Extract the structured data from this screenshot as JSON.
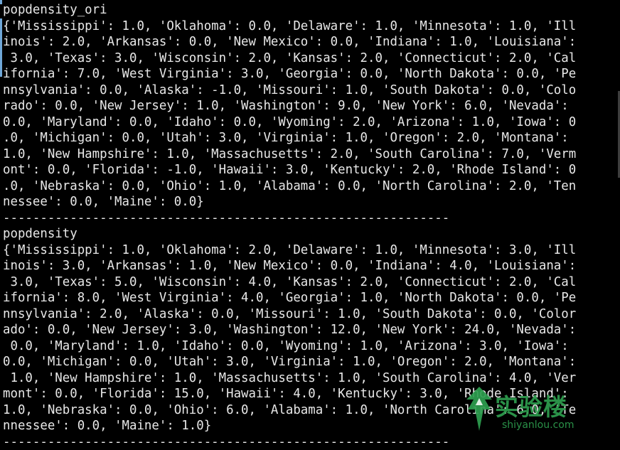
{
  "terminal": {
    "lines": [
      "popdensity_ori",
      "{'Mississippi': 1.0, 'Oklahoma': 0.0, 'Delaware': 1.0, 'Minnesota': 1.0, 'Ill",
      "inois': 2.0, 'Arkansas': 0.0, 'New Mexico': 0.0, 'Indiana': 1.0, 'Louisiana':",
      " 3.0, 'Texas': 3.0, 'Wisconsin': 2.0, 'Kansas': 2.0, 'Connecticut': 2.0, 'Cal",
      "ifornia': 7.0, 'West Virginia': 3.0, 'Georgia': 0.0, 'North Dakota': 0.0, 'Pe",
      "nnsylvania': 0.0, 'Alaska': -1.0, 'Missouri': 1.0, 'South Dakota': 0.0, 'Colo",
      "rado': 0.0, 'New Jersey': 1.0, 'Washington': 9.0, 'New York': 6.0, 'Nevada':",
      "0.0, 'Maryland': 0.0, 'Idaho': 0.0, 'Wyoming': 2.0, 'Arizona': 1.0, 'Iowa': 0",
      ".0, 'Michigan': 0.0, 'Utah': 3.0, 'Virginia': 1.0, 'Oregon': 2.0, 'Montana':",
      "1.0, 'New Hampshire': 1.0, 'Massachusetts': 2.0, 'South Carolina': 7.0, 'Verm",
      "ont': 0.0, 'Florida': -1.0, 'Hawaii': 3.0, 'Kentucky': 2.0, 'Rhode Island': 0",
      ".0, 'Nebraska': 0.0, 'Ohio': 1.0, 'Alabama': 0.0, 'North Carolina': 2.0, 'Ten",
      "nessee': 0.0, 'Maine': 0.0}",
      "------------------------------------------------------------",
      "popdensity",
      "{'Mississippi': 1.0, 'Oklahoma': 2.0, 'Delaware': 1.0, 'Minnesota': 3.0, 'Ill",
      "inois': 3.0, 'Arkansas': 1.0, 'New Mexico': 0.0, 'Indiana': 4.0, 'Louisiana':",
      " 3.0, 'Texas': 5.0, 'Wisconsin': 4.0, 'Kansas': 2.0, 'Connecticut': 2.0, 'Cal",
      "ifornia': 8.0, 'West Virginia': 4.0, 'Georgia': 1.0, 'North Dakota': 0.0, 'Pe",
      "nnsylvania': 2.0, 'Alaska': 0.0, 'Missouri': 1.0, 'South Dakota': 0.0, 'Color",
      "ado': 0.0, 'New Jersey': 3.0, 'Washington': 12.0, 'New York': 24.0, 'Nevada':",
      " 0.0, 'Maryland': 1.0, 'Idaho': 0.0, 'Wyoming': 1.0, 'Arizona': 3.0, 'Iowa':",
      "0.0, 'Michigan': 0.0, 'Utah': 3.0, 'Virginia': 1.0, 'Oregon': 2.0, 'Montana':",
      " 1.0, 'New Hampshire': 1.0, 'Massachusetts': 1.0, 'South Carolina': 4.0, 'Ver",
      "mont': 0.0, 'Florida': 15.0, 'Hawaii': 4.0, 'Kentucky': 3.0, 'Rhode Island':",
      "1.0, 'Nebraska': 0.0, 'Ohio': 6.0, 'Alabama': 1.0, 'North Carolina': 6.0, 'Te",
      "nnessee': 0.0, 'Maine': 1.0}",
      "------------------------------------------------------------"
    ]
  },
  "watermark": {
    "chinese": "实验楼",
    "site": "shiyanlou.com"
  },
  "colors": {
    "background": "#000000",
    "text": "#e8e8e8",
    "accent": "#6fa7d8",
    "watermark": "#2e9e4f"
  }
}
